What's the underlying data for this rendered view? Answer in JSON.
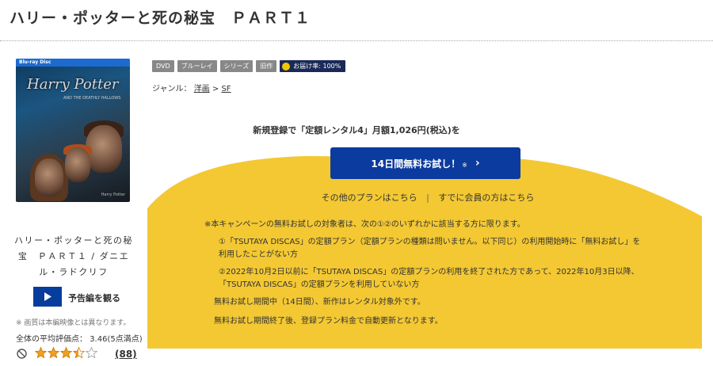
{
  "header": {
    "title": "ハリー・ポッターと死の秘宝　ＰＡＲＴ１"
  },
  "cover": {
    "brand": "Blu-ray Disc",
    "title_art": "Harry Potter",
    "subtitle_art": "AND THE DEATHLY HALLOWS",
    "footer_art": "Harry Potter"
  },
  "sidebar": {
    "caption": "ハリー・ポッターと死の秘宝　ＰＡＲＴ１ / ダニエル・ラドクリフ",
    "trailer_label": "予告編を観る",
    "image_note": "※ 画質は本編映像とは異なります。",
    "avg_rating_text": "全体の平均評価点： 3.46(5点満点)",
    "rating_value": 3.46,
    "rating_max": 5,
    "review_count": "(88)"
  },
  "badges": [
    "DVD",
    "ブルーレイ",
    "シリーズ",
    "旧作"
  ],
  "delivery_badge": "お届け率: 100%",
  "genre": {
    "label": "ジャンル：",
    "items": [
      "洋画",
      "SF"
    ],
    "separator": ">"
  },
  "promo": {
    "headline": "新規登録で「定額レンタル4」月額1,026円(税込)を",
    "cta_label": "14日間無料お試し！",
    "cta_mark": "※",
    "other_plans": "その他のプランはこちら",
    "divider": "|",
    "member_link": "すでに会員の方はこちら",
    "terms": [
      "※本キャンペーンの無料お試しの対象者は、次の①②のいずれかに該当する方に限ります。",
      "①「TSUTAYA DISCAS」の定額プラン（定額プランの種類は問いません。以下同じ）の利用開始時に「無料お試し」を",
      "利用したことがない方",
      "②2022年10月2日以前に「TSUTAYA DISCAS」の定額プランの利用を終了された方であって、2022年10月3日以降、",
      "「TSUTAYA DISCAS」の定額プランを利用していない方",
      "無料お試し期間中（14日間）、新作はレンタル対象外です。",
      "無料お試し期間終了後、登録プラン料金で自動更新となります。"
    ]
  },
  "colors": {
    "promo_yellow": "#f3c833",
    "cta_blue": "#0b3b9e",
    "star": "#f0a020",
    "delivery_badge": "#1a2957"
  }
}
